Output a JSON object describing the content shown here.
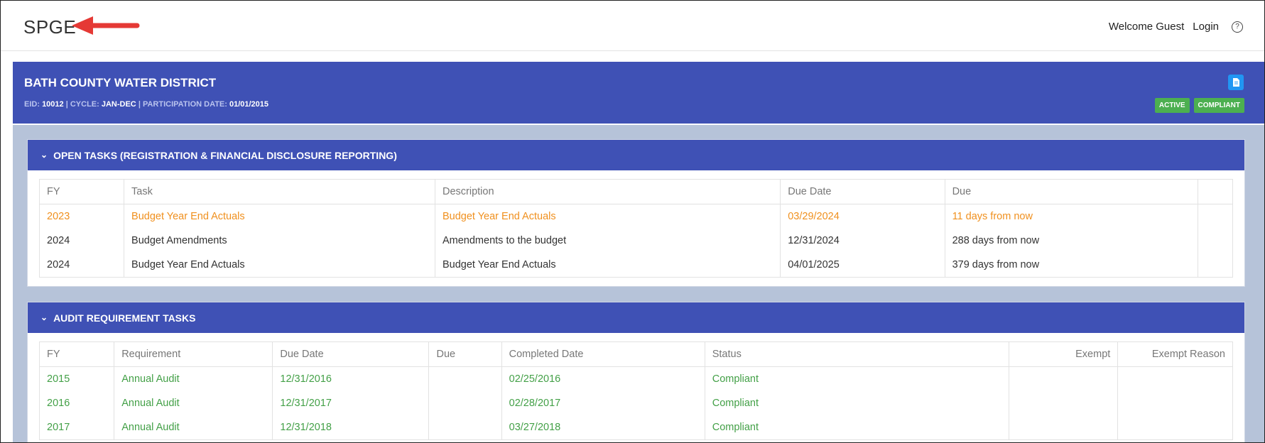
{
  "header": {
    "logo": "SPGE",
    "welcome": "Welcome Guest",
    "login": "Login",
    "help": "?"
  },
  "org": {
    "name": "BATH COUNTY WATER DISTRICT",
    "eid_label": "EID: ",
    "eid": "10012",
    "cycle_label": " | CYCLE: ",
    "cycle": "JAN-DEC",
    "part_label": " | PARTICIPATION DATE: ",
    "participation_date": "01/01/2015",
    "badges": [
      "ACTIVE",
      "COMPLIANT"
    ]
  },
  "open_tasks": {
    "title": "OPEN TASKS (REGISTRATION & FINANCIAL DISCLOSURE REPORTING)",
    "columns": [
      "FY",
      "Task",
      "Description",
      "Due Date",
      "Due",
      ""
    ],
    "rows": [
      {
        "status": "orange",
        "cells": [
          "2023",
          "Budget Year End Actuals",
          "Budget Year End Actuals",
          "03/29/2024",
          "11 days from now",
          ""
        ]
      },
      {
        "status": "normal",
        "cells": [
          "2024",
          "Budget Amendments",
          "Amendments to the budget",
          "12/31/2024",
          "288 days from now",
          ""
        ]
      },
      {
        "status": "normal",
        "cells": [
          "2024",
          "Budget Year End Actuals",
          "Budget Year End Actuals",
          "04/01/2025",
          "379 days from now",
          ""
        ]
      }
    ]
  },
  "audit_tasks": {
    "title": "AUDIT REQUIREMENT TASKS",
    "columns": [
      "FY",
      "Requirement",
      "Due Date",
      "Due",
      "Completed Date",
      "Status",
      "Exempt",
      "Exempt Reason"
    ],
    "rows": [
      {
        "status": "green",
        "cells": [
          "2015",
          "Annual Audit",
          "12/31/2016",
          "",
          "02/25/2016",
          "Compliant",
          "",
          ""
        ]
      },
      {
        "status": "green",
        "cells": [
          "2016",
          "Annual Audit",
          "12/31/2017",
          "",
          "02/28/2017",
          "Compliant",
          "",
          ""
        ]
      },
      {
        "status": "green",
        "cells": [
          "2017",
          "Annual Audit",
          "12/31/2018",
          "",
          "03/27/2018",
          "Compliant",
          "",
          ""
        ]
      }
    ]
  },
  "colors": {
    "header_blue": "#3f51b5",
    "badge_green": "#4caf50",
    "overdue_orange": "#f0901e",
    "compliant_green": "#43a047",
    "annotation_arrow_red": "#e53935"
  },
  "icons": [
    "red-arrow-annotation",
    "help-icon",
    "document-icon",
    "chevron-down-icon"
  ]
}
